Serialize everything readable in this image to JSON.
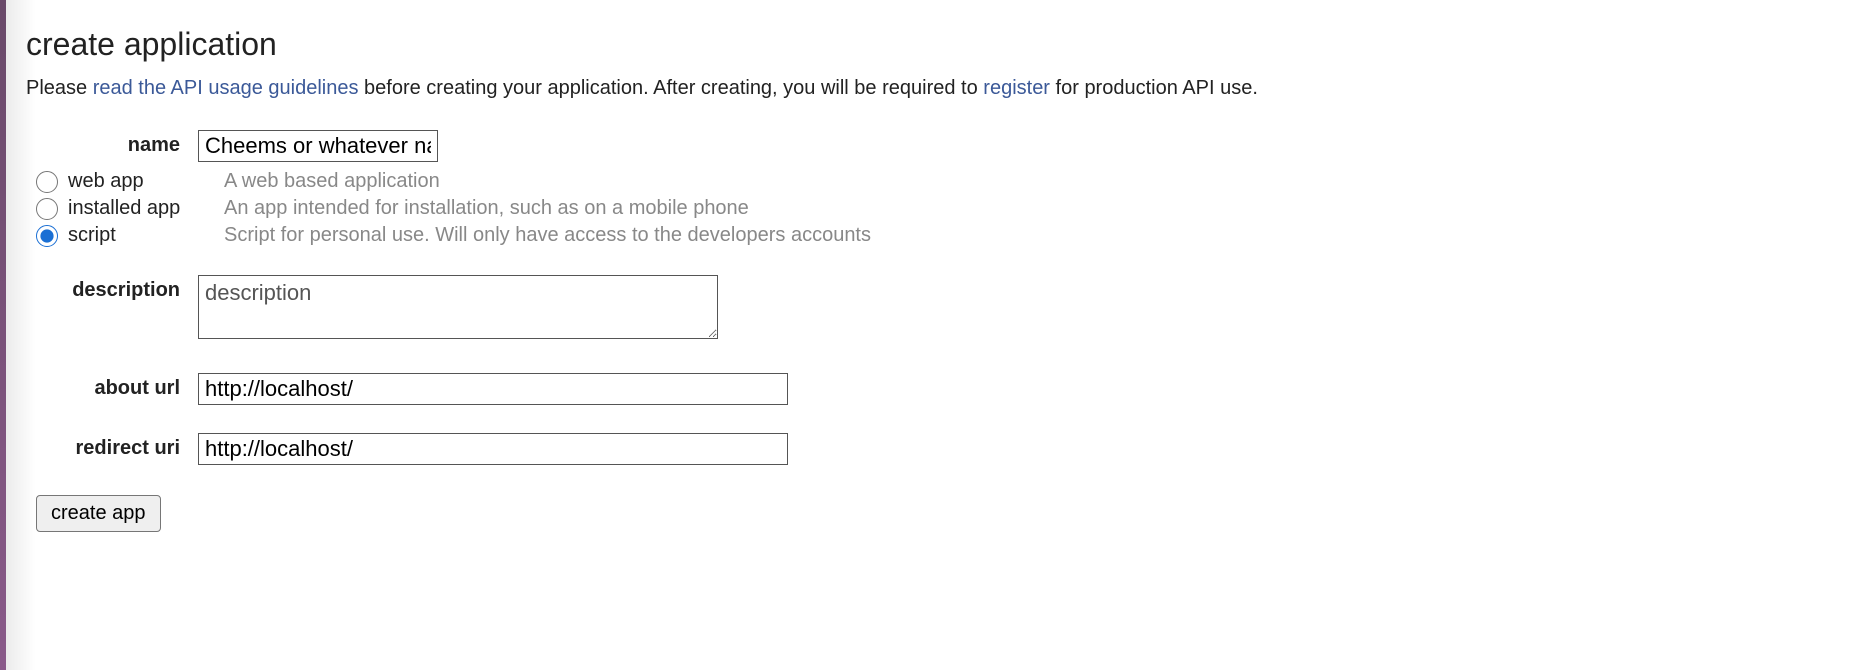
{
  "heading": "create application",
  "intro": {
    "prefix": "Please ",
    "link1": "read the API usage guidelines",
    "middle": " before creating your application. After creating, you will be required to ",
    "link2": "register",
    "suffix": " for production API use."
  },
  "form": {
    "name": {
      "label": "name",
      "value": "Cheems or whatever name u want"
    },
    "app_type": {
      "selected": "script",
      "options": [
        {
          "value": "web",
          "label": "web app",
          "desc": "A web based application"
        },
        {
          "value": "installed",
          "label": "installed app",
          "desc": "An app intended for installation, such as on a mobile phone"
        },
        {
          "value": "script",
          "label": "script",
          "desc": "Script for personal use. Will only have access to the developers accounts"
        }
      ]
    },
    "description": {
      "label": "description",
      "placeholder": "description",
      "value": ""
    },
    "about_url": {
      "label": "about url",
      "value": "http://localhost/"
    },
    "redirect_uri": {
      "label": "redirect uri",
      "value": "http://localhost/"
    },
    "submit_label": "create app"
  }
}
